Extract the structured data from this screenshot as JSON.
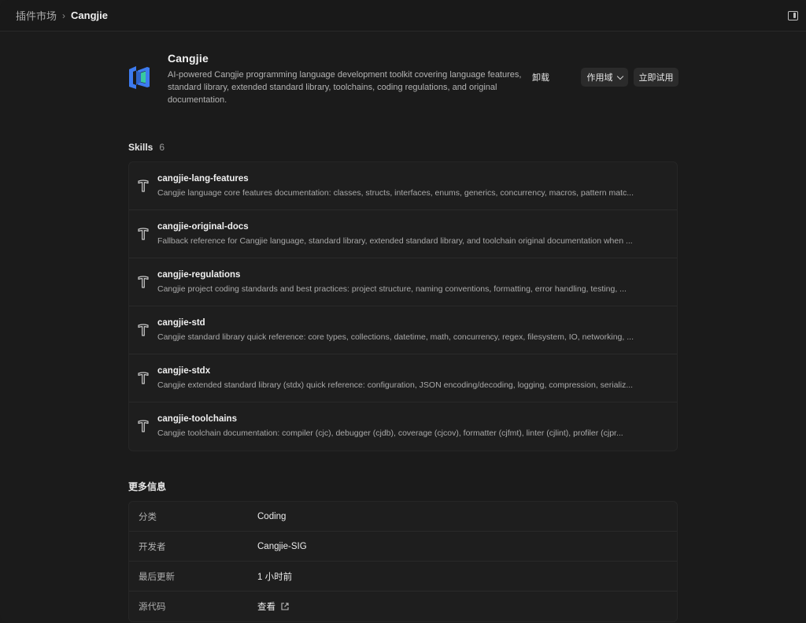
{
  "breadcrumb": {
    "parent": "插件市场",
    "separator": "›",
    "current": "Cangjie"
  },
  "plugin": {
    "name": "Cangjie",
    "description": "AI-powered Cangjie programming language development toolkit covering language features, standard library, extended standard library, toolchains, coding regulations, and original documentation.",
    "logo_icon": "cangjie-logo",
    "actions": {
      "uninstall": "卸载",
      "scope": "作用域",
      "try_now": "立即试用"
    }
  },
  "skills": {
    "label": "Skills",
    "count": "6",
    "items": [
      {
        "name": "cangjie-lang-features",
        "description": "Cangjie language core features documentation: classes, structs, interfaces, enums, generics, concurrency, macros, pattern matc..."
      },
      {
        "name": "cangjie-original-docs",
        "description": "Fallback reference for Cangjie language, standard library, extended standard library, and toolchain original documentation when ..."
      },
      {
        "name": "cangjie-regulations",
        "description": "Cangjie project coding standards and best practices: project structure, naming conventions, formatting, error handling, testing, ..."
      },
      {
        "name": "cangjie-std",
        "description": "Cangjie standard library quick reference: core types, collections, datetime, math, concurrency, regex, filesystem, IO, networking, ..."
      },
      {
        "name": "cangjie-stdx",
        "description": "Cangjie extended standard library (stdx) quick reference: configuration, JSON encoding/decoding, logging, compression, serializ..."
      },
      {
        "name": "cangjie-toolchains",
        "description": "Cangjie toolchain documentation: compiler (cjc), debugger (cjdb), coverage (cjcov), formatter (cjfmt), linter (cjlint), profiler (cjpr..."
      }
    ]
  },
  "more_info": {
    "label": "更多信息",
    "rows": [
      {
        "key": "分类",
        "value": "Coding"
      },
      {
        "key": "开发者",
        "value": "Cangjie-SIG"
      },
      {
        "key": "最后更新",
        "value": "1 小时前"
      },
      {
        "key": "源代码",
        "value": "查看"
      }
    ]
  },
  "colors": {
    "background": "#1b1b1b",
    "logo_blue": "#3d7bf0",
    "logo_green": "#38c9a0"
  }
}
